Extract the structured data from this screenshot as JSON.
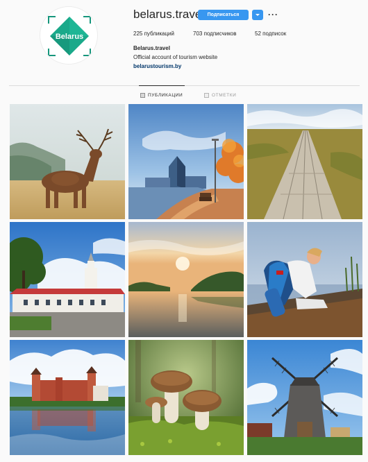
{
  "profile": {
    "username": "belarus.travel",
    "follow_label": "Подписаться",
    "avatar_text": "Belarus",
    "full_name": "Belarus.travel",
    "bio": "Official account of tourism website",
    "link": "belarustourism.by",
    "stats": {
      "posts": "225 публикаций",
      "followers": "703 подписчиков",
      "following": "52 подписок"
    }
  },
  "tabs": {
    "posts": "ПУБЛИКАЦИИ",
    "tagged": "ОТМЕТКИ"
  },
  "photos": [
    {
      "subject": "deer"
    },
    {
      "subject": "library-building"
    },
    {
      "subject": "wooden-boardwalk"
    },
    {
      "subject": "white-church"
    },
    {
      "subject": "river-sunrise"
    },
    {
      "subject": "hiker"
    },
    {
      "subject": "mir-castle"
    },
    {
      "subject": "mushrooms"
    },
    {
      "subject": "windmill"
    }
  ],
  "colors": {
    "accent": "#3897f0",
    "link": "#003569",
    "logo": "#1aa98a"
  },
  "icons": [
    "chevron-down-icon",
    "more-options-icon",
    "grid-icon",
    "tag-icon"
  ]
}
